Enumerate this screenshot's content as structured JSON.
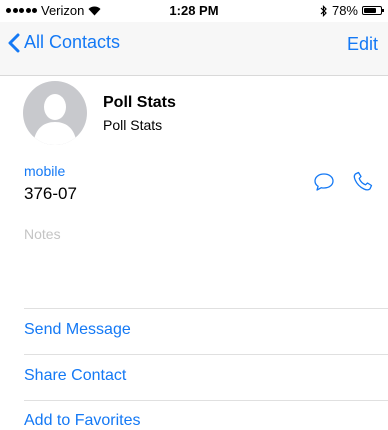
{
  "status_bar": {
    "carrier": "Verizon",
    "time": "1:28 PM",
    "battery_percent": "78%",
    "battery_level": 0.78
  },
  "nav": {
    "back_label": "All Contacts",
    "edit_label": "Edit"
  },
  "contact": {
    "name": "Poll Stats",
    "company": "Poll Stats"
  },
  "phone": {
    "label": "mobile",
    "number": "376-07"
  },
  "notes": {
    "label": "Notes"
  },
  "actions": {
    "send_message": "Send Message",
    "share_contact": "Share Contact",
    "add_to_favorites": "Add to Favorites"
  },
  "colors": {
    "accent": "#1479f5",
    "avatar_bg": "#c8c9cd"
  },
  "icons": {
    "back": "chevron-left-icon",
    "message": "speech-bubble-icon",
    "call": "phone-icon",
    "bluetooth": "bluetooth-icon",
    "wifi": "wifi-icon",
    "battery": "battery-icon"
  }
}
